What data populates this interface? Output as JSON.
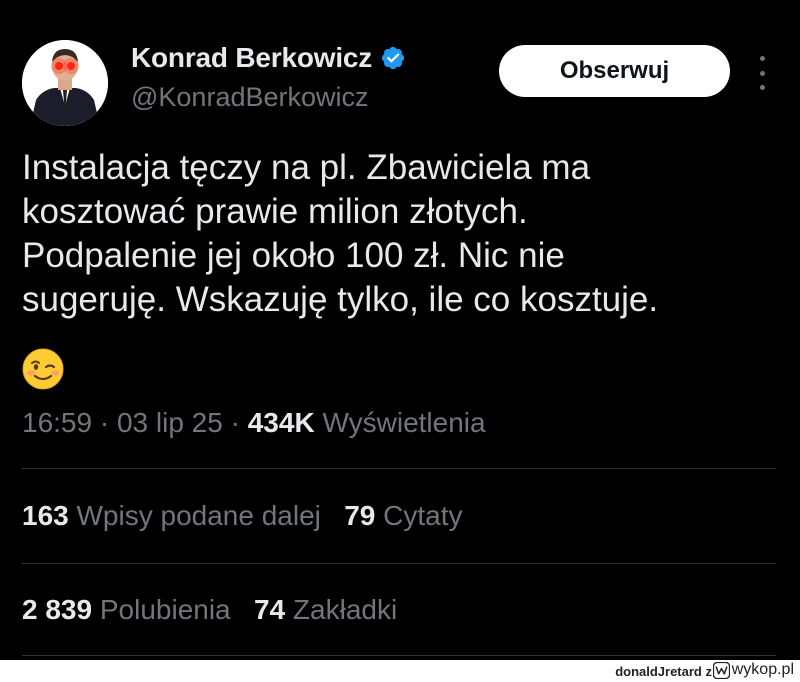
{
  "author": {
    "display_name": "Konrad Berkowicz",
    "handle": "@KonradBerkowicz",
    "verified": true,
    "avatar": "avatar-photo"
  },
  "follow_button": {
    "label": "Obserwuj"
  },
  "more_icon": "more-options-icon",
  "tweet": {
    "lines": [
      "Instalacja tęczy na pl. Zbawiciela ma",
      "kosztować prawie milion złotych.",
      "Podpalenie jej około 100 zł. Nic nie",
      "sugeruję. Wskazuję tylko, ile co kosztuje."
    ],
    "emoji": "winking-face"
  },
  "meta": {
    "time": "16:59",
    "sep1": " · ",
    "date": "03 lip 25",
    "sep2": " · ",
    "views_count": "434K",
    "views_label": " Wyświetlenia"
  },
  "stats": {
    "reposts_count": "163",
    "reposts_label": "Wpisy podane dalej",
    "quotes_count": "79",
    "quotes_label": "Cytaty",
    "likes_count": "2 839",
    "likes_label": "Polubienia",
    "bookmarks_count": "74",
    "bookmarks_label": "Zakładki"
  },
  "footer": {
    "user": "donaldJretard",
    "z": "z",
    "brand": "wykop.pl"
  },
  "colors": {
    "background": "#000000",
    "text_primary": "#e7e9ea",
    "text_secondary": "#71767b",
    "divider": "#2f3336",
    "verified_badge": "#1d9bf0",
    "follow_button_bg": "#ffffff"
  }
}
